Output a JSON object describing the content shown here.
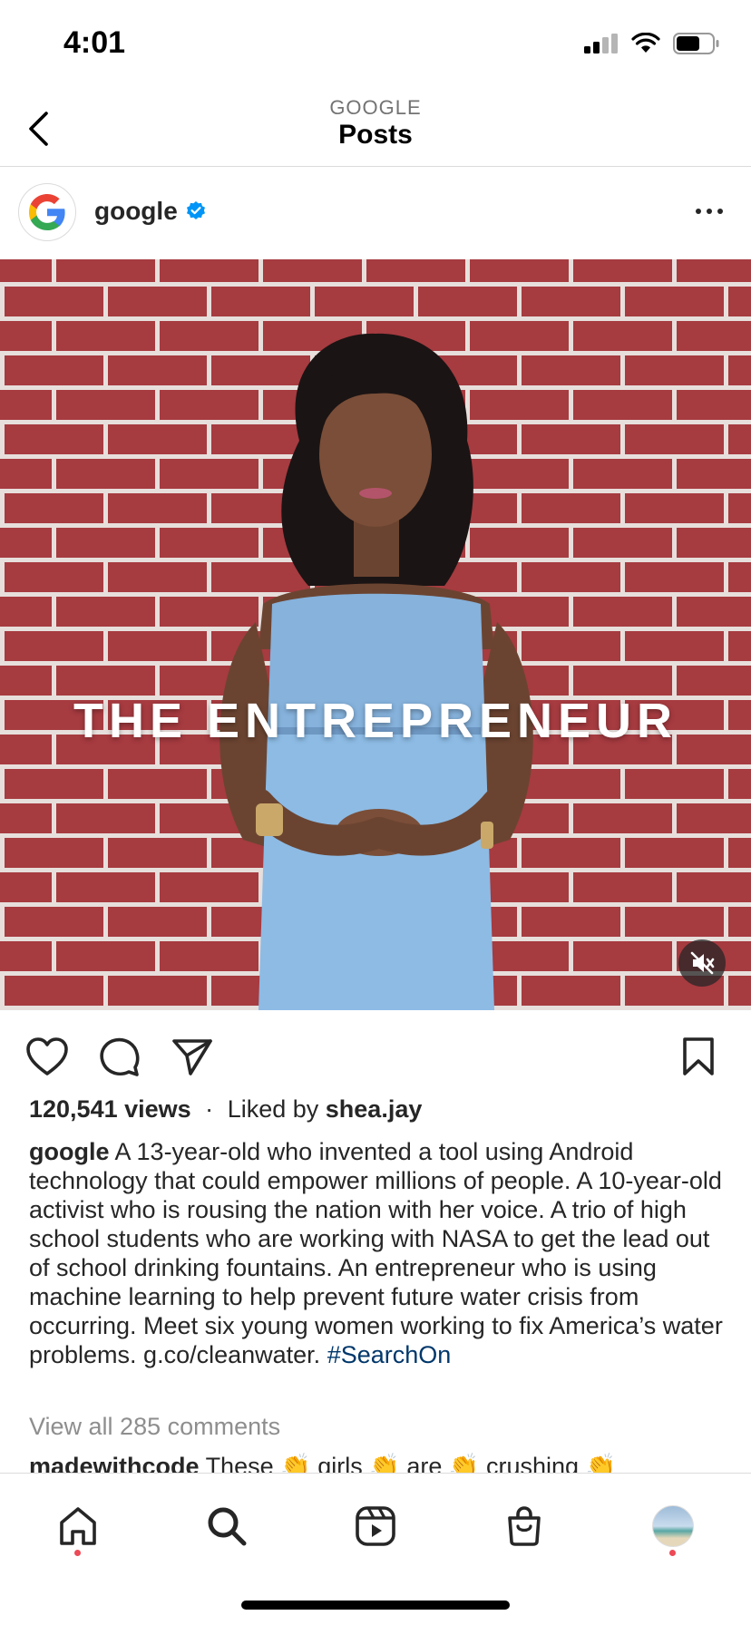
{
  "status_bar": {
    "time": "4:01"
  },
  "header": {
    "subtitle": "GOOGLE",
    "title": "Posts"
  },
  "post": {
    "username": "google",
    "media_caption": "THE ENTREPRENEUR",
    "views": "120,541 views",
    "separator": "·",
    "liked_by_prefix": "Liked by",
    "liked_by_user": "shea.jay",
    "caption_user": "google",
    "caption_text": "A 13-year-old who invented a tool using Android technology that could empower millions of people. A 10-year-old activist who is rousing the nation with her voice. A trio of high school students who are working with NASA to get the lead out of school drinking fountains. An entrepreneur who is using machine learning to help prevent future water crisis from occurring. Meet six young women working to fix America’s water problems. g.co/cleanwater.",
    "hashtag": "#SearchOn",
    "view_comments": "View all 285 comments",
    "comment_user": "madewithcode",
    "comment_text": "These 👏 girls 👏 are 👏 crushing 👏"
  },
  "colors": {
    "text": "#262626",
    "secondary": "#8e8e8e",
    "link": "#00376b",
    "verified": "#0095f6",
    "notification_dot": "#ed4956",
    "brick": "#a63b40"
  },
  "icons": {
    "back": "chevron-left-icon",
    "like": "heart-icon",
    "comment": "comment-icon",
    "share": "paper-plane-icon",
    "save": "bookmark-icon",
    "mute": "speaker-muted-icon",
    "nav": [
      "home-icon",
      "search-icon",
      "reels-icon",
      "shop-icon",
      "profile-avatar"
    ]
  }
}
